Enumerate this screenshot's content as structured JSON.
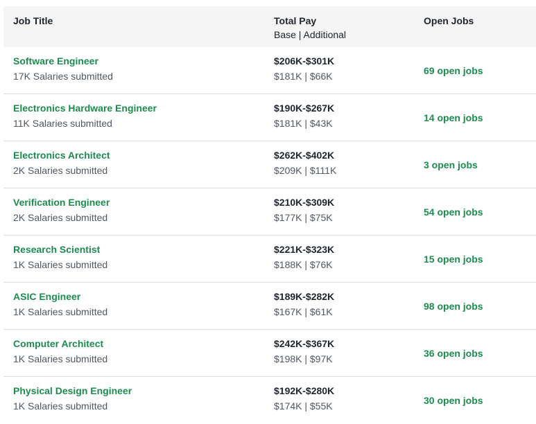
{
  "header": {
    "job_title": "Job Title",
    "total_pay": "Total Pay",
    "total_pay_sub": "Base | Additional",
    "open_jobs": "Open Jobs"
  },
  "rows": [
    {
      "title": "Software Engineer",
      "salaries": "17K Salaries submitted",
      "pay_range": "$206K-$301K",
      "breakdown": "$181K | $66K",
      "open_jobs": "69 open jobs"
    },
    {
      "title": "Electronics Hardware Engineer",
      "salaries": "11K Salaries submitted",
      "pay_range": "$190K-$267K",
      "breakdown": "$181K | $43K",
      "open_jobs": "14 open jobs"
    },
    {
      "title": "Electronics Architect",
      "salaries": "2K Salaries submitted",
      "pay_range": "$262K-$402K",
      "breakdown": "$209K | $111K",
      "open_jobs": "3 open jobs"
    },
    {
      "title": "Verification Engineer",
      "salaries": "2K Salaries submitted",
      "pay_range": "$210K-$309K",
      "breakdown": "$177K | $75K",
      "open_jobs": "54 open jobs"
    },
    {
      "title": "Research Scientist",
      "salaries": "1K Salaries submitted",
      "pay_range": "$221K-$323K",
      "breakdown": "$188K | $76K",
      "open_jobs": "15 open jobs"
    },
    {
      "title": "ASIC Engineer",
      "salaries": "1K Salaries submitted",
      "pay_range": "$189K-$282K",
      "breakdown": "$167K | $61K",
      "open_jobs": "98 open jobs"
    },
    {
      "title": "Computer Architect",
      "salaries": "1K Salaries submitted",
      "pay_range": "$242K-$367K",
      "breakdown": "$198K | $97K",
      "open_jobs": "36 open jobs"
    },
    {
      "title": "Physical Design Engineer",
      "salaries": "1K Salaries submitted",
      "pay_range": "$192K-$280K",
      "breakdown": "$174K | $55K",
      "open_jobs": "30 open jobs"
    }
  ],
  "colors": {
    "link_green": "#1c8c4e",
    "header_bg": "#f5f5f6",
    "text_dark": "#20262e",
    "text_muted": "#505863",
    "divider": "#dedede"
  }
}
